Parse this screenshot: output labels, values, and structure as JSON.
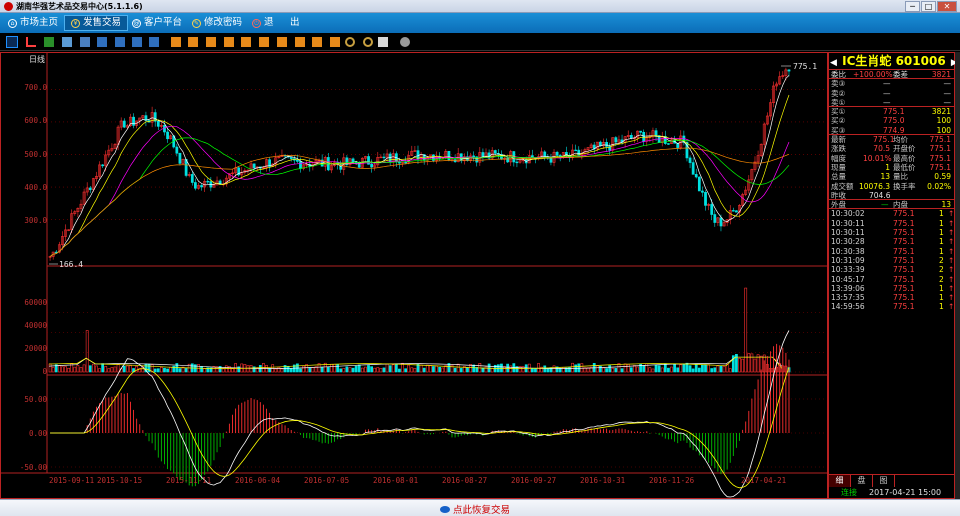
{
  "window": {
    "title": "湖南华强艺术品交易中心(5.1.1.6)",
    "minimize": "─",
    "maximize": "□",
    "close": "✕"
  },
  "menu": {
    "items": [
      {
        "label": "市场主页",
        "icon": "home-icon"
      },
      {
        "label": "发售交易",
        "icon": "yen-icon"
      },
      {
        "label": "客户平台",
        "icon": "user-icon"
      },
      {
        "label": "修改密码",
        "icon": "key-icon"
      },
      {
        "label": "退",
        "icon": "power-icon"
      },
      {
        "label": "出",
        "icon": ""
      }
    ],
    "active_index": 1
  },
  "chart": {
    "period_label": "日线",
    "price_axis": [
      "700.0",
      "600.0",
      "500.0",
      "400.0",
      "300.0"
    ],
    "high_marker": "775.1",
    "low_marker": "166.4",
    "volume_axis": [
      "60000",
      "40000",
      "20000",
      "0"
    ],
    "macd_axis": [
      "50.00",
      "0.00",
      "-50.00"
    ],
    "dates": [
      "2015-09-11",
      "2015-10-15",
      "2015-11-11",
      "2016-06-04",
      "2016-07-05",
      "2016-08-01",
      "2016-08-27",
      "2016-09-27",
      "2016-10-31",
      "2016-11-26",
      "2017-04-21"
    ],
    "colors": {
      "up": "#ff3030",
      "down": "#00e0e0",
      "grid": "#8a0000",
      "axis": "#b22222"
    }
  },
  "chart_data": {
    "type": "candlestick",
    "title": "日线",
    "ylim": [
      166.4,
      775.1
    ],
    "x_tick_labels": [
      "2015-09-11",
      "2015-10-15",
      "2015-11-11",
      "2016-06-04",
      "2016-07-05",
      "2016-08-01",
      "2016-08-27",
      "2016-09-27",
      "2016-10-31",
      "2016-11-26",
      "2017-04-21"
    ],
    "price_ticks": [
      300,
      400,
      500,
      600,
      700
    ],
    "volume_ticks": [
      0,
      20000,
      40000,
      60000
    ],
    "macd_ticks": [
      -50,
      0,
      50
    ],
    "price_trend_approx": [
      {
        "date": "2015-09-11",
        "price": 180
      },
      {
        "date": "2015-10-15",
        "price": 600
      },
      {
        "date": "2015-11-11",
        "price": 400
      },
      {
        "date": "2016-06-04",
        "price": 480
      },
      {
        "date": "2016-07-05",
        "price": 470
      },
      {
        "date": "2016-08-01",
        "price": 500
      },
      {
        "date": "2016-08-27",
        "price": 495
      },
      {
        "date": "2016-09-27",
        "price": 490
      },
      {
        "date": "2016-10-31",
        "price": 560
      },
      {
        "date": "2016-11-26",
        "price": 520
      },
      {
        "date": "2017-04-21",
        "price": 775.1
      }
    ],
    "highest": 775.1,
    "lowest": 166.4
  },
  "quote": {
    "name": "IC生肖蛇",
    "code": "601006",
    "weibi_label": "委比",
    "weibi": "+100.00%",
    "weicha_label": "委差",
    "weicha": "3821",
    "asks": [
      {
        "label": "卖③",
        "price": "—",
        "vol": "—"
      },
      {
        "label": "卖②",
        "price": "—",
        "vol": "—"
      },
      {
        "label": "卖①",
        "price": "—",
        "vol": "—"
      }
    ],
    "bids": [
      {
        "label": "买①",
        "price": "775.1",
        "vol": "3821"
      },
      {
        "label": "买②",
        "price": "775.0",
        "vol": "100"
      },
      {
        "label": "买③",
        "price": "774.9",
        "vol": "100"
      }
    ],
    "stats": [
      {
        "l1": "最新",
        "v1": "775.1",
        "l2": "均价",
        "v2": "775.1"
      },
      {
        "l1": "涨跌",
        "v1": "70.5",
        "l2": "开盘价",
        "v2": "775.1"
      },
      {
        "l1": "幅度",
        "v1": "10.01%",
        "l2": "最高价",
        "v2": "775.1"
      },
      {
        "l1": "现量",
        "v1": "1",
        "l2": "最低价",
        "v2": "775.1"
      },
      {
        "l1": "总量",
        "v1": "13",
        "l2": "量比",
        "v2": "0.59"
      },
      {
        "l1": "成交额",
        "v1": "10076.3",
        "l2": "换手率",
        "v2": "0.02%"
      },
      {
        "l1": "昨收",
        "v1": "704.6",
        "l2": "",
        "v2": ""
      }
    ],
    "outer_label": "外盘",
    "outer_value": "—",
    "inner_label": "内盘",
    "inner_value": "13"
  },
  "ticks": [
    {
      "time": "10:30:02",
      "price": "775.1",
      "vol": "1"
    },
    {
      "time": "10:30:11",
      "price": "775.1",
      "vol": "1"
    },
    {
      "time": "10:30:11",
      "price": "775.1",
      "vol": "1"
    },
    {
      "time": "10:30:28",
      "price": "775.1",
      "vol": "1"
    },
    {
      "time": "10:30:38",
      "price": "775.1",
      "vol": "1"
    },
    {
      "time": "10:31:09",
      "price": "775.1",
      "vol": "2"
    },
    {
      "time": "10:33:39",
      "price": "775.1",
      "vol": "2"
    },
    {
      "time": "10:45:17",
      "price": "775.1",
      "vol": "2"
    },
    {
      "time": "13:39:06",
      "price": "775.1",
      "vol": "1"
    },
    {
      "time": "13:57:35",
      "price": "775.1",
      "vol": "1"
    },
    {
      "time": "14:59:56",
      "price": "775.1",
      "vol": "1"
    }
  ],
  "rtabs": [
    "细",
    "盘",
    "图"
  ],
  "status": {
    "connection": "连接",
    "datetime": "2017-04-21 15:00"
  },
  "footer": {
    "resume_label": "点此恢复交易"
  }
}
